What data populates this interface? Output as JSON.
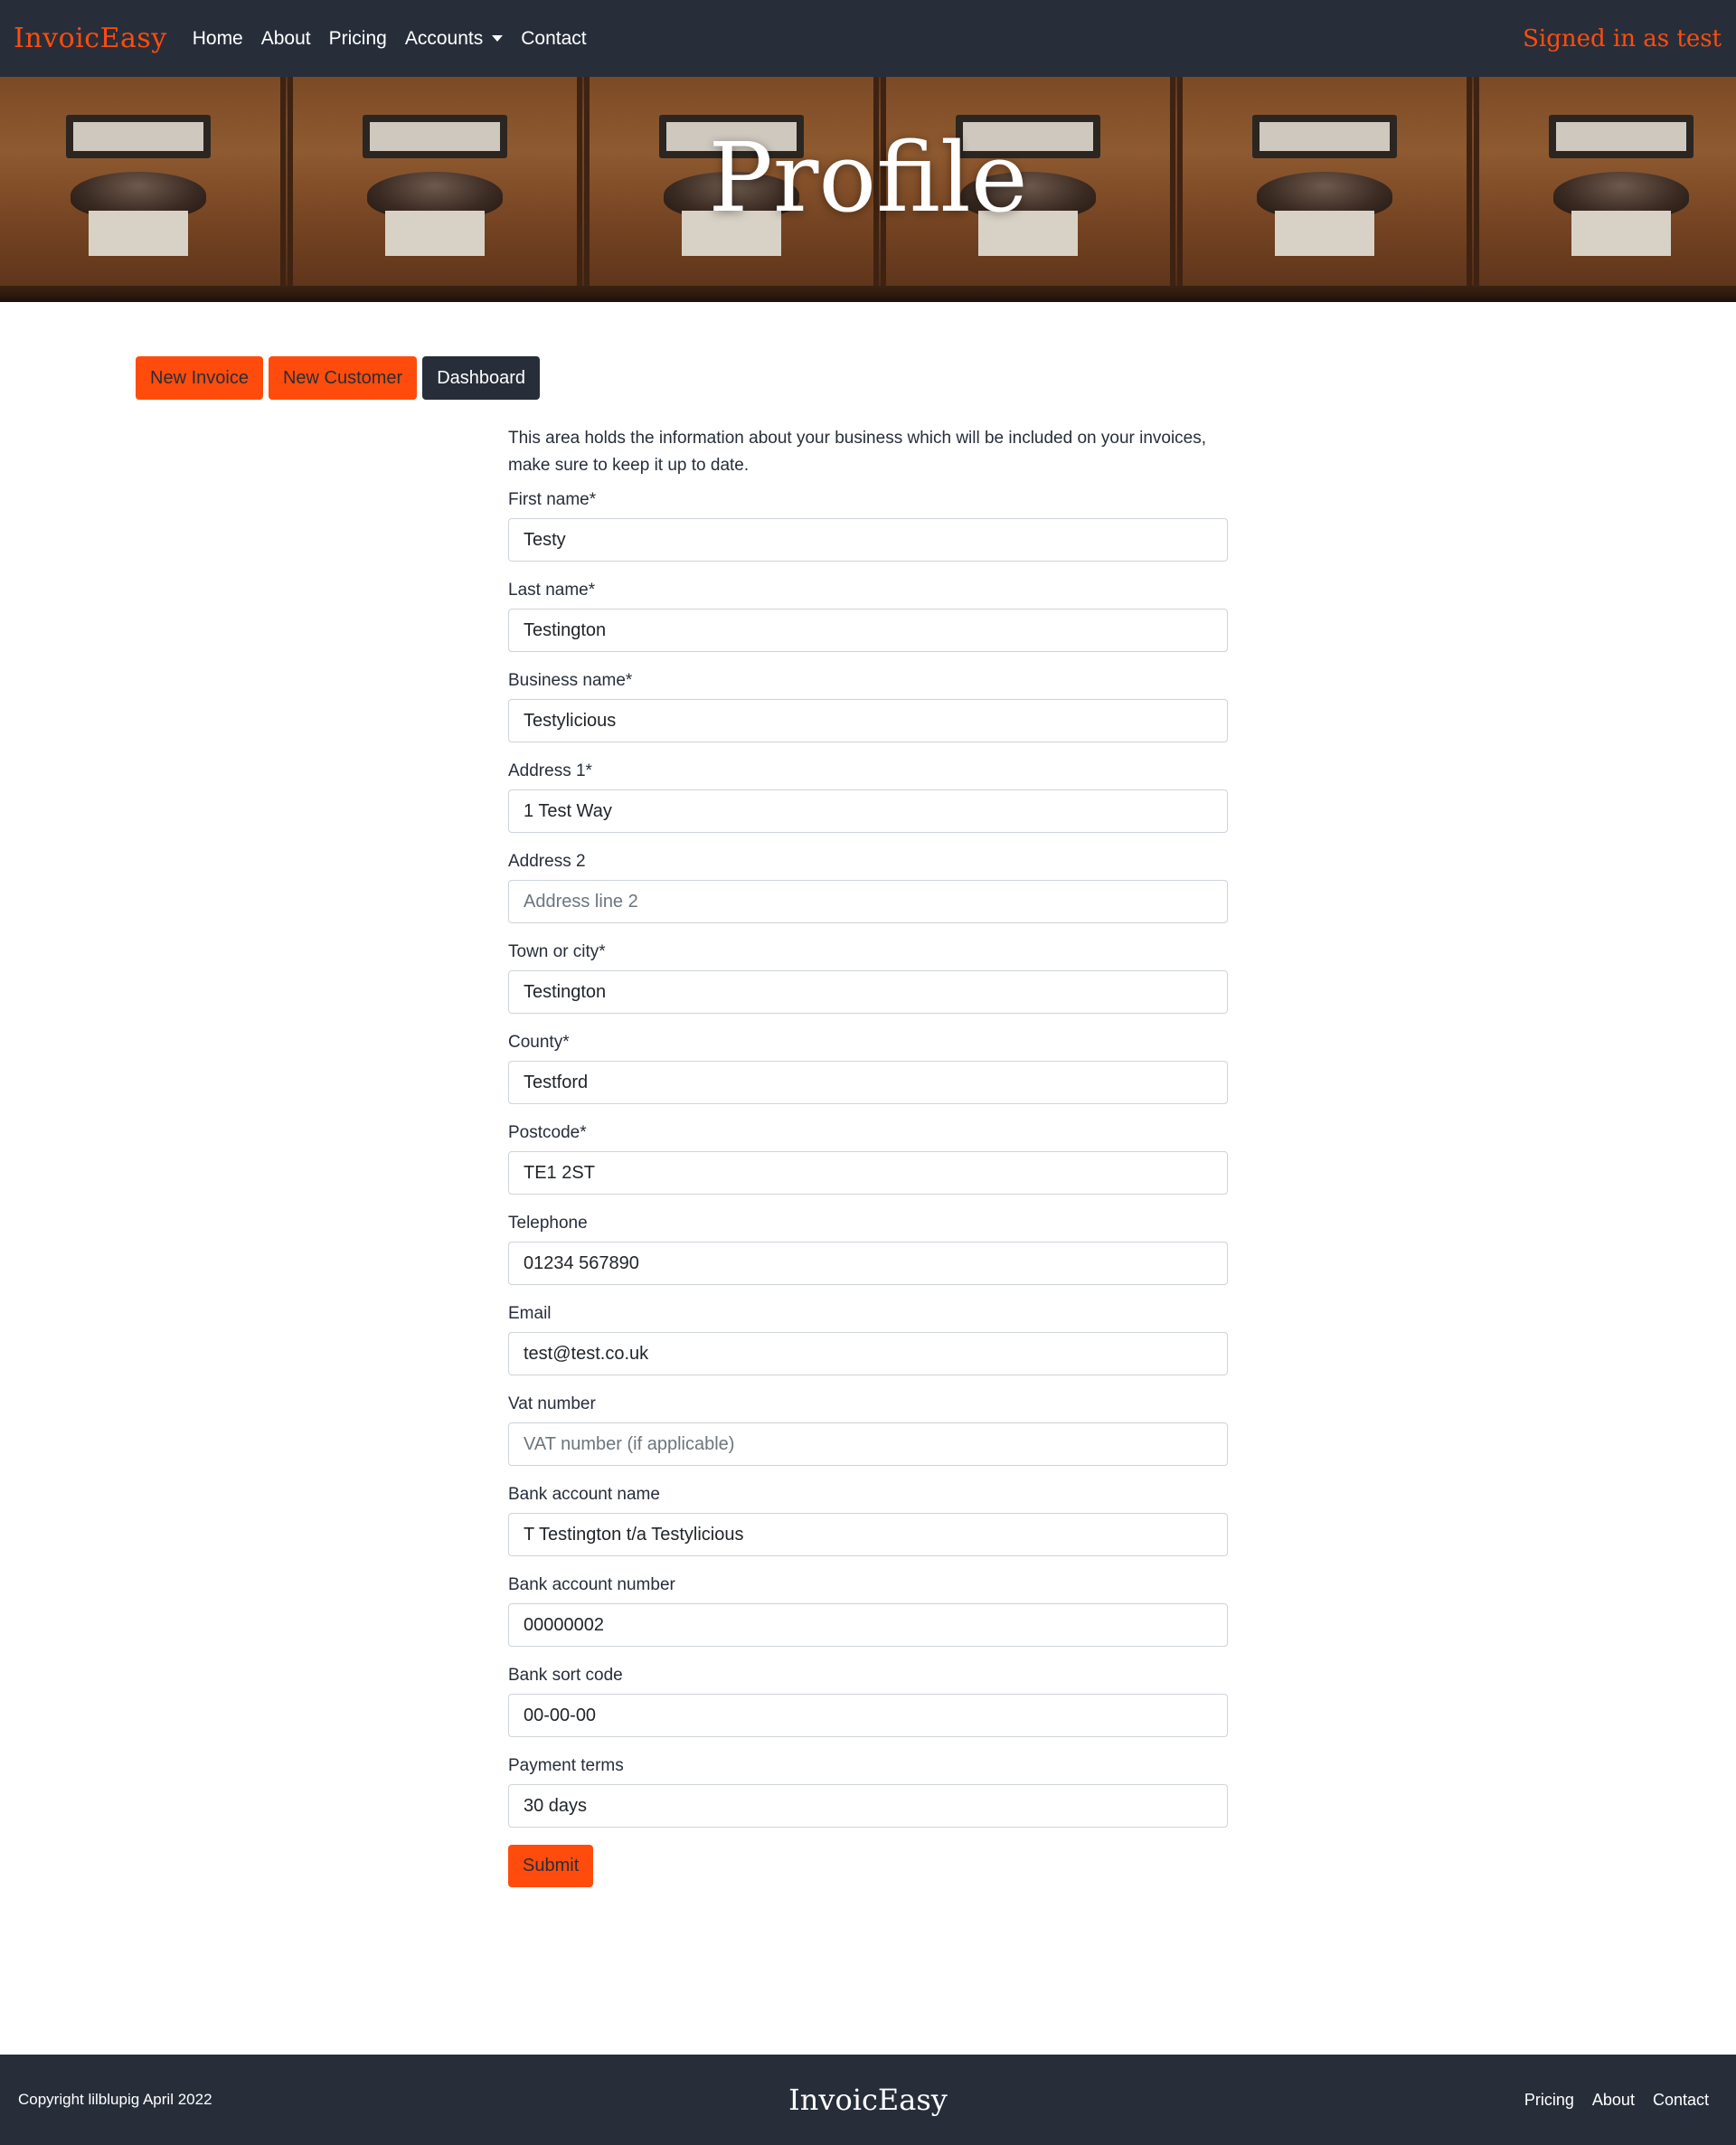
{
  "navbar": {
    "brand": "InvoicEasy",
    "links": [
      "Home",
      "About",
      "Pricing",
      "Accounts",
      "Contact"
    ],
    "signed_in": "Signed in as test"
  },
  "hero": {
    "title": "Profile"
  },
  "actions": {
    "new_invoice": "New Invoice",
    "new_customer": "New Customer",
    "dashboard": "Dashboard"
  },
  "form": {
    "intro": "This area holds the information about your business which will be included on your invoices, make sure to keep it up to date.",
    "fields": [
      {
        "label": "First name*",
        "value": "Testy",
        "placeholder": ""
      },
      {
        "label": "Last name*",
        "value": "Testington",
        "placeholder": ""
      },
      {
        "label": "Business name*",
        "value": "Testylicious",
        "placeholder": ""
      },
      {
        "label": "Address 1*",
        "value": "1 Test Way",
        "placeholder": ""
      },
      {
        "label": "Address 2",
        "value": "",
        "placeholder": "Address line 2"
      },
      {
        "label": "Town or city*",
        "value": "Testington",
        "placeholder": ""
      },
      {
        "label": "County*",
        "value": "Testford",
        "placeholder": ""
      },
      {
        "label": "Postcode*",
        "value": "TE1 2ST",
        "placeholder": ""
      },
      {
        "label": "Telephone",
        "value": "01234 567890",
        "placeholder": ""
      },
      {
        "label": "Email",
        "value": "test@test.co.uk",
        "placeholder": ""
      },
      {
        "label": "Vat number",
        "value": "",
        "placeholder": "VAT number (if applicable)"
      },
      {
        "label": "Bank account name",
        "value": "T Testington t/a Testylicious",
        "placeholder": ""
      },
      {
        "label": "Bank account number",
        "value": "00000002",
        "placeholder": ""
      },
      {
        "label": "Bank sort code",
        "value": "00-00-00",
        "placeholder": ""
      },
      {
        "label": "Payment terms",
        "value": "30 days",
        "placeholder": ""
      }
    ],
    "submit": "Submit"
  },
  "footer": {
    "copyright": "Copyright lilblupig April 2022",
    "brand": "InvoicEasy",
    "links": [
      "Pricing",
      "About",
      "Contact"
    ]
  },
  "colors": {
    "accent": "#ff4c0c",
    "navbar_bg": "#272e3a"
  }
}
